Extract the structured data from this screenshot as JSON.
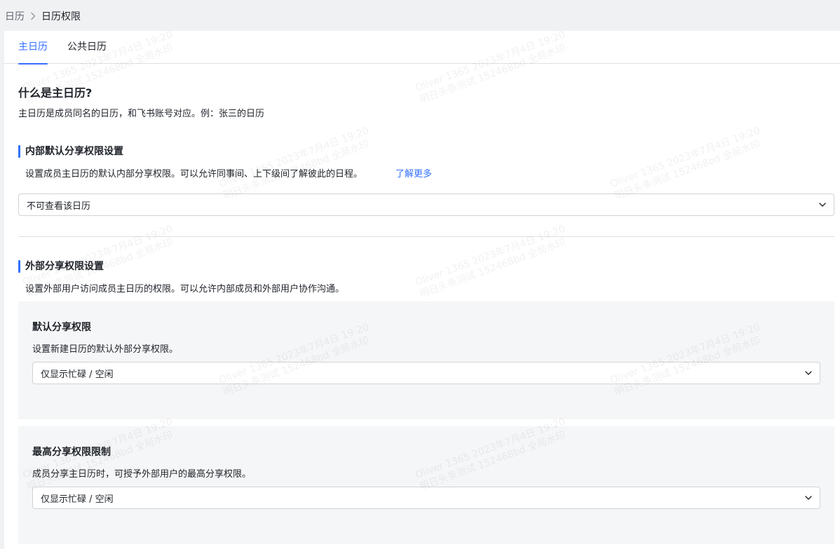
{
  "breadcrumb": {
    "parent": "日历",
    "current": "日历权限"
  },
  "tabs": [
    {
      "label": "主日历",
      "active": true
    },
    {
      "label": "公共日历",
      "active": false
    }
  ],
  "intro": {
    "title": "什么是主日历?",
    "desc": "主日历是成员同名的日历，和飞书账号对应。例：张三的日历"
  },
  "internal": {
    "title": "内部默认分享权限设置",
    "desc": "设置成员主日历的默认内部分享权限。可以允许同事间、上下级间了解彼此的日程。",
    "learn_more": "了解更多",
    "select_value": "不可查看该日历"
  },
  "external": {
    "title": "外部分享权限设置",
    "desc": "设置外部用户访问成员主日历的权限。可以允许内部成员和外部用户协作沟通。",
    "default_card": {
      "title": "默认分享权限",
      "desc": "设置新建日历的默认外部分享权限。",
      "select_value": "仅显示忙碌 / 空闲"
    },
    "max_card": {
      "title": "最高分享权限限制",
      "desc": "成员分享主日历时，可授予外部用户的最高分享权限。",
      "select_value": "仅显示忙碌 / 空闲"
    }
  },
  "watermark": {
    "line1": "Oliver 1365 2023年7月4日 19:20",
    "line2": "明日头条测试 152468bd 全局水印"
  },
  "colors": {
    "accent": "#3370ff",
    "text": "#1f2329",
    "muted": "#646a73",
    "card_bg": "#f5f6f7",
    "page_bg": "#f0f1f3"
  }
}
